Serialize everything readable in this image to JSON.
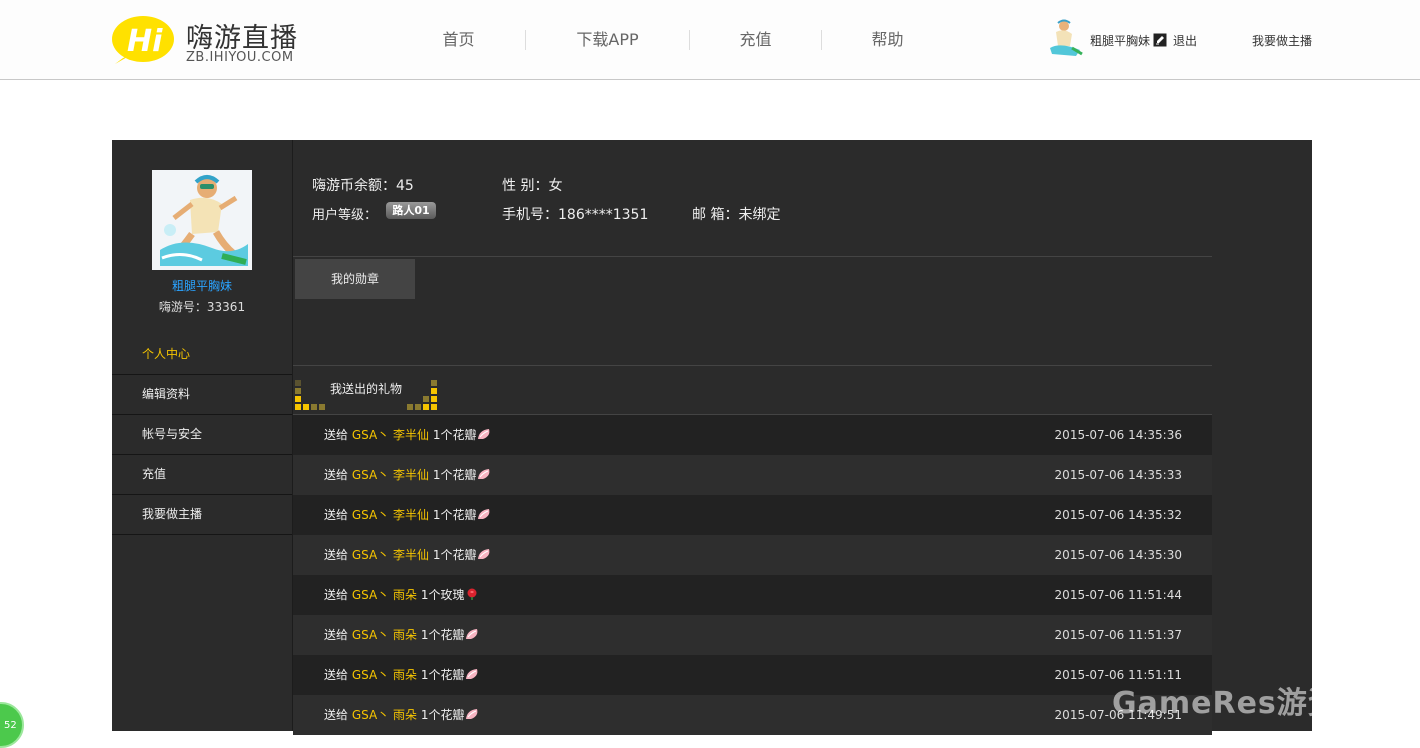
{
  "header": {
    "logo_title": "嗨游直播",
    "logo_sub": "ZB.IHIYOU.COM",
    "nav": [
      "首页",
      "下载APP",
      "充值",
      "帮助"
    ],
    "username": "粗腿平胸妹",
    "logout_label": "退出",
    "be_host_label": "我要做主播"
  },
  "profile": {
    "name": "粗腿平胸妹",
    "id_label": "嗨游号：33361"
  },
  "sidebar": {
    "items": [
      {
        "label": "个人中心"
      },
      {
        "label": "编辑资料"
      },
      {
        "label": "帐号与安全"
      },
      {
        "label": "充值"
      },
      {
        "label": "我要做主播"
      }
    ]
  },
  "info": {
    "balance": "嗨游币余额：45",
    "gender": "性 别：女",
    "level_label": "用户等级：",
    "level_badge": "路人01",
    "phone": "手机号：186****1351",
    "email": "邮 箱：未绑定"
  },
  "tabs": {
    "medals": "我的勋章",
    "gifts_sent": "我送出的礼物"
  },
  "gifts": [
    {
      "prefix": "送给",
      "recipient": "GSA丶 李半仙",
      "amount": "1个花瓣",
      "icon": "petal-icon",
      "time": "2015-07-06 14:35:36"
    },
    {
      "prefix": "送给",
      "recipient": "GSA丶 李半仙",
      "amount": "1个花瓣",
      "icon": "petal-icon",
      "time": "2015-07-06 14:35:33"
    },
    {
      "prefix": "送给",
      "recipient": "GSA丶 李半仙",
      "amount": "1个花瓣",
      "icon": "petal-icon",
      "time": "2015-07-06 14:35:32"
    },
    {
      "prefix": "送给",
      "recipient": "GSA丶 李半仙",
      "amount": "1个花瓣",
      "icon": "petal-icon",
      "time": "2015-07-06 14:35:30"
    },
    {
      "prefix": "送给",
      "recipient": "GSA丶 雨朵",
      "amount": "1个玫瑰",
      "icon": "rose-icon",
      "time": "2015-07-06 11:51:44"
    },
    {
      "prefix": "送给",
      "recipient": "GSA丶 雨朵",
      "amount": "1个花瓣",
      "icon": "petal-icon",
      "time": "2015-07-06 11:51:37"
    },
    {
      "prefix": "送给",
      "recipient": "GSA丶 雨朵",
      "amount": "1个花瓣",
      "icon": "petal-icon",
      "time": "2015-07-06 11:51:11"
    },
    {
      "prefix": "送给",
      "recipient": "GSA丶 雨朵",
      "amount": "1个花瓣",
      "icon": "petal-icon",
      "time": "2015-07-06 11:49:51"
    }
  ],
  "watermark": "GameRes游资网",
  "corner_badge": "52",
  "colors": {
    "accent_yellow": "#f5c400",
    "link_blue": "#2aa3ff",
    "panel_bg": "#2b2b2b",
    "row_dark": "#222222",
    "row_light": "#2e2e2e"
  }
}
